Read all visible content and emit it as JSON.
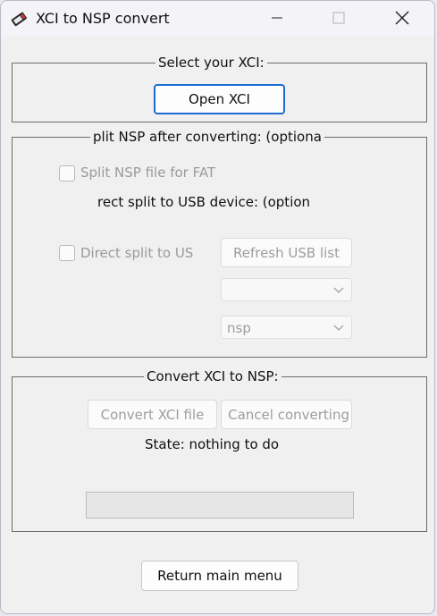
{
  "window": {
    "title": "XCI to NSP convert",
    "minimize_glyph": "—",
    "maximize_glyph": "☐",
    "close_glyph": "✕"
  },
  "select_group": {
    "legend": "Select your XCI:",
    "open_button": "Open XCI"
  },
  "split_group": {
    "legend": "plit NSP after converting: (optiona",
    "split_fat_label": "Split NSP file for FAT",
    "direct_split_heading": "rect split to USB device: (option",
    "direct_split_label": "Direct split to US",
    "refresh_button": "Refresh USB list",
    "usb_device_value": "",
    "format_value": "nsp"
  },
  "convert_group": {
    "legend": "Convert XCI to NSP:",
    "convert_button": "Convert XCI file",
    "cancel_button": "Cancel converting",
    "state_text": "State: nothing to do",
    "progress": 0
  },
  "footer": {
    "return_button": "Return main menu"
  },
  "icons": {
    "app": "cartridge-icon",
    "chevron": "chevron-down-icon"
  },
  "colors": {
    "accent": "#1d6cd0",
    "disabled_text": "#9d9d9d"
  }
}
